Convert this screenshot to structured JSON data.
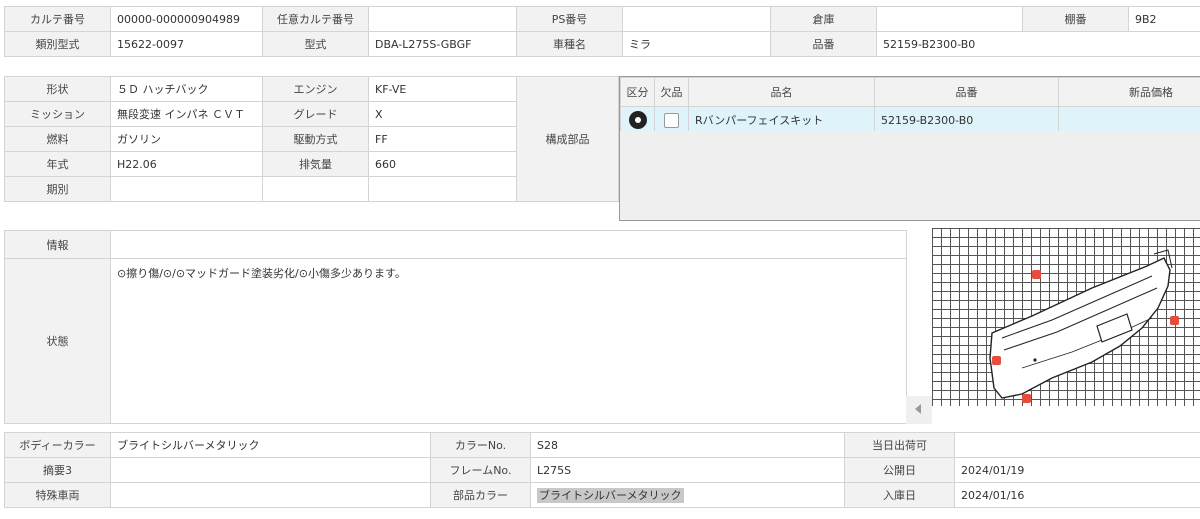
{
  "header": {
    "karte_no_label": "カルテ番号",
    "karte_no": "00000-000000904989",
    "nini_karte_label": "任意カルテ番号",
    "nini_karte": "",
    "ps_label": "PS番号",
    "ps": "",
    "souko_label": "倉庫",
    "souko": "",
    "tana_label": "棚番",
    "tana": "9B2",
    "ruibetsu_label": "類別型式",
    "ruibetsu": "15622-0097",
    "katashiki_label": "型式",
    "katashiki": "DBA-L275S-GBGF",
    "shashu_label": "車種名",
    "shashu": "ミラ",
    "hinban_label": "品番",
    "hinban": "52159-B2300-B0"
  },
  "spec": {
    "keijou_label": "形状",
    "keijou": "５Ｄ ハッチバック",
    "engine_label": "エンジン",
    "engine": "KF-VE",
    "mission_label": "ミッション",
    "mission": "無段変速 インパネ ＣＶＴ",
    "grade_label": "グレード",
    "grade": "X",
    "nenryou_label": "燃料",
    "nenryou": "ガソリン",
    "kudou_label": "駆動方式",
    "kudou": "FF",
    "nenshiki_label": "年式",
    "nenshiki": "H22.06",
    "haikiryou_label": "排気量",
    "haikiryou": "660",
    "kibetsu_label": "期別",
    "kibetsu": "",
    "kousei_label": "構成部品"
  },
  "parts_table": {
    "headers": [
      "区分",
      "欠品",
      "品名",
      "品番",
      "新品価格"
    ],
    "rows": [
      {
        "name": "Rバンパーフェイスキット",
        "number": "52159-B2300-B0",
        "price": ""
      }
    ]
  },
  "info": {
    "joho_label": "情報",
    "joho": "",
    "joutai_label": "状態",
    "joutai": "⊙擦り傷/⊙/⊙マッドガード塗装劣化/⊙小傷多少あります。"
  },
  "bottom": {
    "body_color_label": "ボディーカラー",
    "body_color": "ブライトシルバーメタリック",
    "color_no_label": "カラーNo.",
    "color_no": "S28",
    "toujitsu_label": "当日出荷可",
    "toujitsu": "",
    "tekiyou3_label": "摘要3",
    "tekiyou3": "",
    "frame_label": "フレームNo.",
    "frame": "L275S",
    "koukai_label": "公開日",
    "koukai": "2024/01/19",
    "tokushu_label": "特殊車両",
    "tokushu": "",
    "buhin_color_label": "部品カラー",
    "buhin_color": "ブライトシルバーメタリック",
    "nyuuko_label": "入庫日",
    "nyuuko": "2024/01/16"
  },
  "diagram": {
    "marker_label": "⊙"
  }
}
